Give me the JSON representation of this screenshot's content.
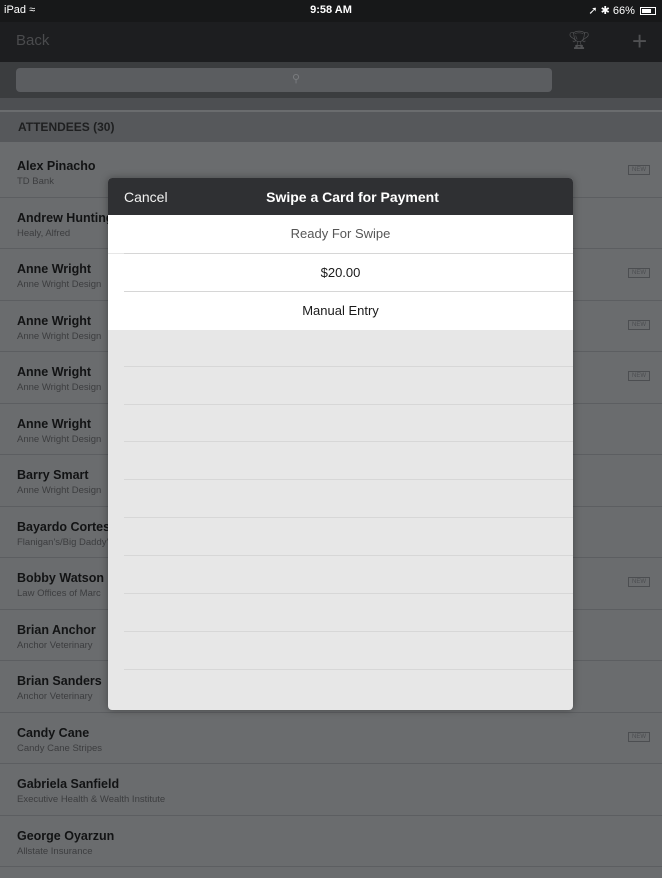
{
  "status_bar": {
    "device": "iPad",
    "time": "9:58 AM",
    "battery": "66%"
  },
  "nav": {
    "back_label": "Back",
    "add_label": "+"
  },
  "section": {
    "title": "ATTENDEES (30)"
  },
  "badge_label": "NEW",
  "attendees": [
    {
      "name": "Alex Pinacho",
      "company": "TD Bank"
    },
    {
      "name": "Andrew Huntington",
      "company": "Healy, Alfred"
    },
    {
      "name": "Anne Wright",
      "company": "Anne Wright Design"
    },
    {
      "name": "Anne Wright",
      "company": "Anne Wright Design"
    },
    {
      "name": "Anne Wright",
      "company": "Anne Wright Design"
    },
    {
      "name": "Anne Wright",
      "company": "Anne Wright Design"
    },
    {
      "name": "Barry Smart",
      "company": "Anne Wright Design"
    },
    {
      "name": "Bayardo Cortes",
      "company": "Flanigan's/Big Daddy's"
    },
    {
      "name": "Bobby Watson",
      "company": "Law Offices of Marc"
    },
    {
      "name": "Brian Anchor",
      "company": "Anchor Veterinary"
    },
    {
      "name": "Brian Sanders",
      "company": "Anchor Veterinary"
    },
    {
      "name": "Candy Cane",
      "company": "Candy Cane Stripes"
    },
    {
      "name": "Gabriela Sanfield",
      "company": "Executive Health & Wealth Institute"
    },
    {
      "name": "George Oyarzun",
      "company": "Allstate Insurance"
    }
  ],
  "modal": {
    "cancel_label": "Cancel",
    "title": "Swipe a Card for Payment",
    "status_text": "Ready For Swipe",
    "amount": "$20.00",
    "manual_entry_label": "Manual Entry"
  }
}
